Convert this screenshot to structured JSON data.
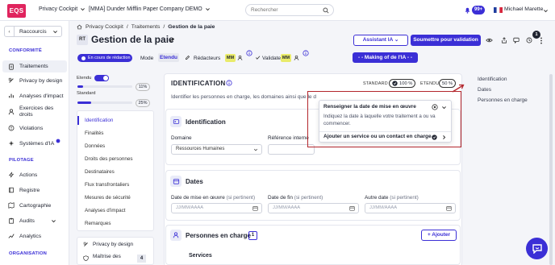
{
  "topbar": {
    "logo": "EQS",
    "workspace": "Privacy Cockpit",
    "company": "[MMA] Dunder Mifflin Paper Company DEMO",
    "search_placeholder": "Rechercher",
    "notif_count": "99+",
    "user_name": "Michael Marette"
  },
  "sidebar": {
    "shortcut_label": "Raccourcis",
    "section_conformite": "CONFORMITÉ",
    "items_conformite": [
      "Traitements",
      "Privacy by design",
      "Analyses d'impact",
      "Exercices des droits",
      "Violations",
      "Systèmes d'IA"
    ],
    "section_pilotage": "PILOTAGE",
    "items_pilotage": [
      "Actions",
      "Registre",
      "Cartographie",
      "Audits",
      "Analytics"
    ],
    "section_organisation": "ORGANISATION"
  },
  "breadcrumb": [
    "Privacy Cockpit",
    "Traitements",
    "Gestion de la paie"
  ],
  "header": {
    "initials": "RT",
    "title": "Gestion de la paie",
    "assistant_label": "Assistant IA",
    "submit_label": "Soumettre pour validation",
    "count_badge": "1"
  },
  "status_row": {
    "status": "En cours de rédaction",
    "mode_label": "Mode",
    "mode_value": "Etendu",
    "redacteurs_label": "Rédacteurs",
    "validateurs_label": "Validateurs",
    "mm": "MM",
    "making_label": "- - Making of de l'IA - -"
  },
  "progress": {
    "etendu_label": "Etendu",
    "etendu_pct": "11%",
    "etendu_fraction": 0.11,
    "standard_label": "Standard",
    "standard_pct": "25%",
    "standard_fraction": 0.25
  },
  "section_nav": [
    "Identification",
    "Finalités",
    "Données",
    "Droits des personnes",
    "Destinataires",
    "Flux transfrontaliers",
    "Mesures de sécurité",
    "Analyses d'impact",
    "Remarques"
  ],
  "bottom_nav": {
    "privacy_by_design": "Privacy by design",
    "maitrise": "Maîtrise des",
    "maitrise_count": "4"
  },
  "identification": {
    "title": "IDENTIFICATION",
    "standard_label": "STANDARD",
    "standard_pct": "100 %",
    "etendu_label": "ETENDU",
    "etendu_pct": "50 %",
    "description": "Identifier les personnes en charge, les domaines ainsi que le d"
  },
  "identification_card": {
    "title": "Identification",
    "domaine_label": "Domaine",
    "domaine_value": "Ressources Humaines",
    "reference_label": "Référence interne"
  },
  "dates_card": {
    "title": "Dates",
    "start_label": "Date de mise en œuvre",
    "end_label": "Date de fin",
    "other_label": "Autre date",
    "qualifier": "(si pertinent)",
    "placeholder": "JJ/MM/AAAA"
  },
  "persons_card": {
    "title": "Personnes en charge",
    "count": "1",
    "add_label": "+ Ajouter",
    "services_label": "Services"
  },
  "popover": {
    "item1_title": "Renseigner la date de mise en œuvre",
    "item1_desc": "Indiquez la date à laquelle votre traitement a ou va commencer.",
    "item2_title": "Ajouter un service ou un contact en charge"
  },
  "toc": [
    "Identification",
    "Dates",
    "Personnes en charge"
  ],
  "colors": {
    "accent": "#3b2fd6",
    "logo": "#e0245e",
    "highlight": "#b3262c",
    "mm_badge": "#e9eb6a"
  }
}
